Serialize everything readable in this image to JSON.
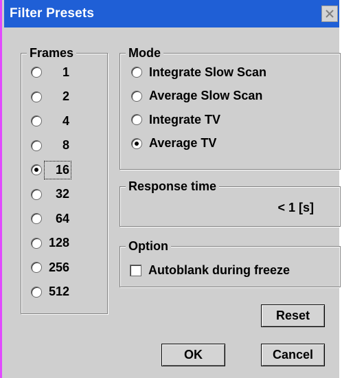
{
  "window": {
    "title": "Filter Presets",
    "close_symbol": "✕"
  },
  "frames": {
    "label": "Frames",
    "options": [
      {
        "value": "1",
        "checked": false
      },
      {
        "value": "2",
        "checked": false
      },
      {
        "value": "4",
        "checked": false
      },
      {
        "value": "8",
        "checked": false
      },
      {
        "value": "16",
        "checked": true
      },
      {
        "value": "32",
        "checked": false
      },
      {
        "value": "64",
        "checked": false
      },
      {
        "value": "128",
        "checked": false
      },
      {
        "value": "256",
        "checked": false
      },
      {
        "value": "512",
        "checked": false
      }
    ]
  },
  "mode": {
    "label": "Mode",
    "options": [
      {
        "value": "Integrate Slow Scan",
        "checked": false
      },
      {
        "value": "Average Slow Scan",
        "checked": false
      },
      {
        "value": "Integrate TV",
        "checked": false
      },
      {
        "value": "Average TV",
        "checked": true
      }
    ]
  },
  "response_time": {
    "label": "Response time",
    "value": "< 1  [s]"
  },
  "option": {
    "label": "Option",
    "autoblank_label": "Autoblank during freeze",
    "autoblank_checked": false
  },
  "buttons": {
    "reset": "Reset",
    "ok": "OK",
    "cancel": "Cancel"
  },
  "colors": {
    "titlebar": "#1f5fd6",
    "dialog_bg": "#cfcfcf",
    "frame_border": "#e14aff"
  }
}
